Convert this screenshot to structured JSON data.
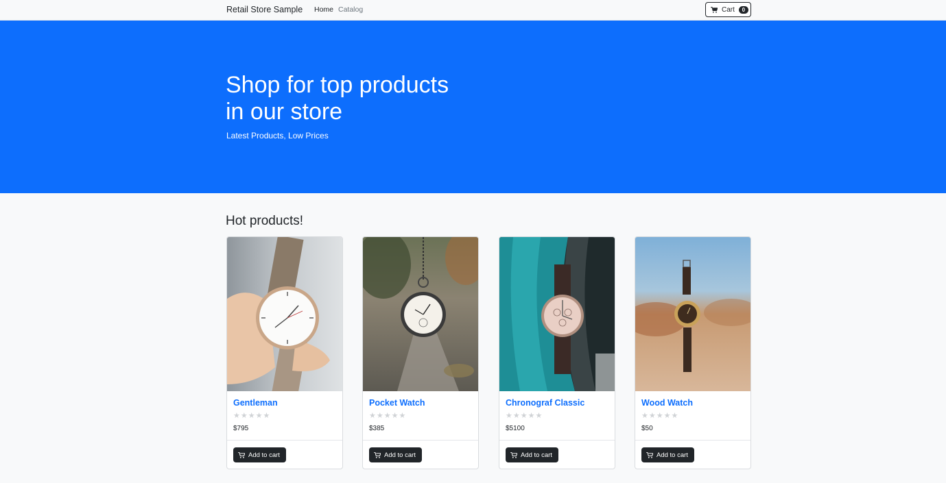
{
  "nav": {
    "brand": "Retail Store Sample",
    "links": [
      "Home",
      "Catalog"
    ],
    "cart_label": "Cart",
    "cart_count": "0"
  },
  "hero": {
    "title": "Shop for top products in our store",
    "subtitle": "Latest Products, Low Prices"
  },
  "section_title": "Hot products!",
  "products": [
    {
      "name": "Gentleman",
      "price": "$795",
      "rating": 0,
      "button": "Add to cart"
    },
    {
      "name": "Pocket Watch",
      "price": "$385",
      "rating": 0,
      "button": "Add to cart"
    },
    {
      "name": "Chronograf Classic",
      "price": "$5100",
      "rating": 0,
      "button": "Add to cart"
    },
    {
      "name": "Wood Watch",
      "price": "$50",
      "rating": 0,
      "button": "Add to cart"
    }
  ],
  "colors": {
    "primary": "#0d6efd",
    "dark": "#212529",
    "star_empty": "#d0d3d6"
  },
  "icons": {
    "cart": "cart-icon"
  }
}
